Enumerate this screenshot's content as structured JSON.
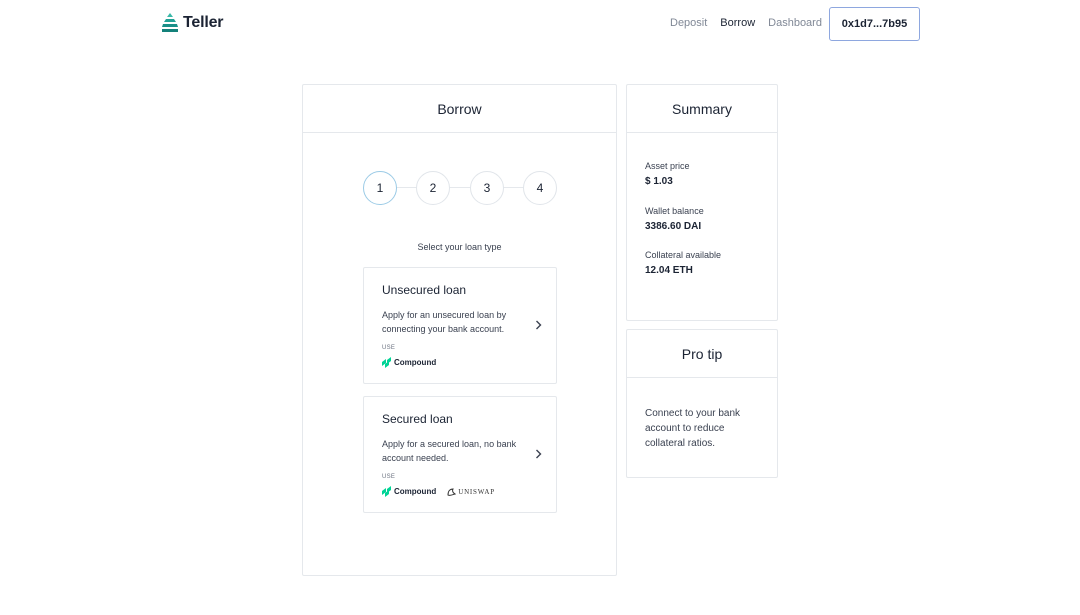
{
  "header": {
    "logo_text": "Teller",
    "nav": [
      {
        "label": "Deposit",
        "active": false
      },
      {
        "label": "Borrow",
        "active": true
      },
      {
        "label": "Dashboard",
        "active": false
      }
    ],
    "wallet_address": "0x1d7...7b95"
  },
  "borrow": {
    "title": "Borrow",
    "steps": [
      "1",
      "2",
      "3",
      "4"
    ],
    "active_step": 1,
    "select_label": "Select your loan type",
    "loans": [
      {
        "title": "Unsecured loan",
        "description": "Apply for an unsecured loan by connecting your bank account.",
        "use_label": "USE",
        "protocols": [
          "Compound"
        ]
      },
      {
        "title": "Secured loan",
        "description": "Apply for a secured loan, no bank account needed.",
        "use_label": "USE",
        "protocols": [
          "Compound",
          "UNISWAP"
        ]
      }
    ]
  },
  "summary": {
    "title": "Summary",
    "items": [
      {
        "label": "Asset price",
        "value": "$ 1.03"
      },
      {
        "label": "Wallet balance",
        "value": "3386.60 DAI"
      },
      {
        "label": "Collateral available",
        "value": "12.04 ETH"
      }
    ]
  },
  "pro_tip": {
    "title": "Pro tip",
    "text": "Connect to your bank account to reduce collateral ratios."
  },
  "colors": {
    "brand_teal": "#1fa39b",
    "compound_green": "#00d395",
    "wallet_border": "#8ea7df",
    "active_step_border": "#9ccbe6"
  },
  "icons": [
    "teller-logo-icon",
    "chevron-right-icon",
    "compound-logo-icon",
    "uniswap-logo-icon"
  ]
}
